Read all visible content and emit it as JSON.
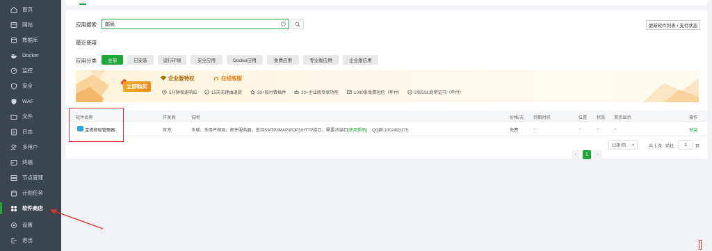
{
  "sidebar": {
    "items": [
      {
        "label": "首页",
        "icon": "home-icon"
      },
      {
        "label": "网站",
        "icon": "globe-icon"
      },
      {
        "label": "数据库",
        "icon": "database-icon"
      },
      {
        "label": "Docker",
        "icon": "docker-icon"
      },
      {
        "label": "监控",
        "icon": "monitor-icon"
      },
      {
        "label": "安全",
        "icon": "shield-icon"
      },
      {
        "label": "WAF",
        "icon": "waf-icon"
      },
      {
        "label": "文件",
        "icon": "folder-icon"
      },
      {
        "label": "日志",
        "icon": "log-icon"
      },
      {
        "label": "多用户",
        "icon": "users-icon"
      },
      {
        "label": "终端",
        "icon": "terminal-icon"
      },
      {
        "label": "节点管理",
        "icon": "node-icon"
      },
      {
        "label": "计划任务",
        "icon": "calendar-icon"
      },
      {
        "label": "软件商店",
        "icon": "grid-icon",
        "active": true
      },
      {
        "label": "设置",
        "icon": "gear-icon"
      },
      {
        "label": "退出",
        "icon": "logout-icon"
      }
    ]
  },
  "store": {
    "search_label": "应用搜索",
    "search_value": "邮局",
    "update_btn": "更新软件列表 / 支付状态",
    "recent_label": "最近使用",
    "category_label": "应用分类",
    "categories": [
      {
        "label": "全部",
        "active": true
      },
      {
        "label": "已安装"
      },
      {
        "label": "运行环境"
      },
      {
        "label": "安全应用"
      },
      {
        "label": "Docker应用"
      },
      {
        "label": "免费应用"
      },
      {
        "label": "专业版应用"
      },
      {
        "label": "企业版应用"
      }
    ]
  },
  "banner": {
    "buy_label": "立即购买",
    "title1": "企业版特权",
    "title2": "在线客服",
    "features": [
      "5分钟极速响应",
      "15天无理由退款",
      "30+款付费插件",
      "20+企业版专享功能",
      "1000条免费短信（年付）",
      "2张SSL商用证书（年付）"
    ]
  },
  "table": {
    "headers": [
      "软件名称",
      "开发商",
      "说明",
      "价格/天",
      "到期时间",
      "位置",
      "状态",
      "首页显示",
      "操作"
    ],
    "rows": [
      {
        "name": "宝塔邮局管理器",
        "developer": "官方",
        "description": "多域、多用户邮局，邮件服务器，支持SMTP/IMAP/POP3/HTTP接口，需要25端口",
        "help": "[使用帮助]",
        "qq": "QQ群:1002493175",
        "price": "免费",
        "expire": "--",
        "position": "--",
        "status": "--",
        "homepage": "--",
        "action": "安装"
      }
    ]
  },
  "pager": {
    "prev": "‹",
    "current": "1",
    "next": "›",
    "per_page": "15条/页",
    "total": "共 1 条",
    "goto_label": "前往",
    "goto_value": "1",
    "page_unit": "页"
  },
  "colors": {
    "accent": "#20a53a",
    "sidebar_bg": "#3c444d",
    "annotation": "#e03030"
  }
}
